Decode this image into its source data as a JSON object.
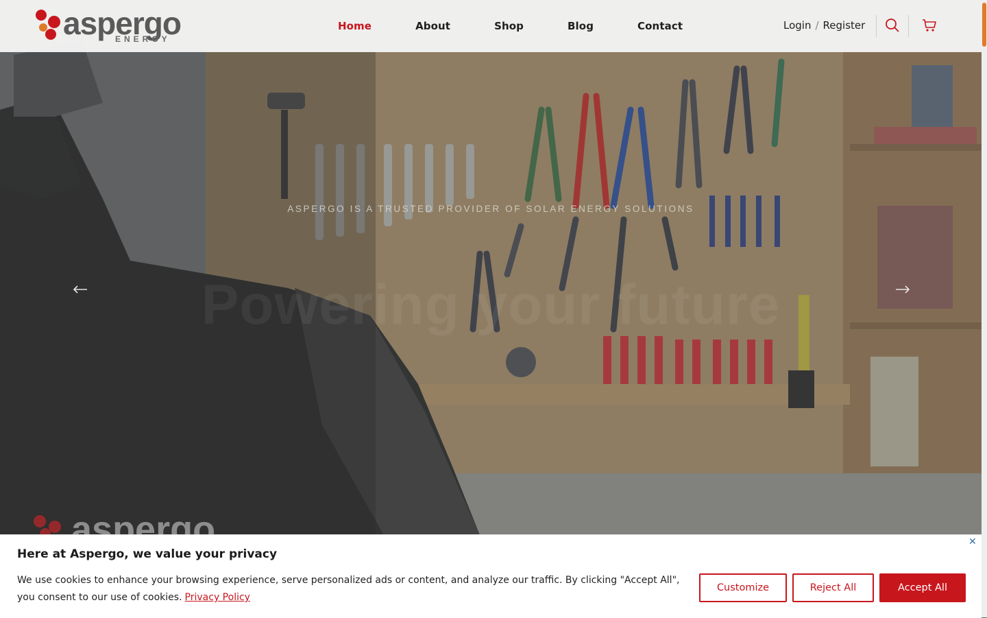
{
  "brand": {
    "logo_text": "aspergo",
    "logo_sub": "ENERGY",
    "primary_color": "#c8161d",
    "accent_color": "#e07a2a"
  },
  "nav": {
    "items": [
      {
        "label": "Home",
        "active": true
      },
      {
        "label": "About",
        "active": false
      },
      {
        "label": "Shop",
        "active": false
      },
      {
        "label": "Blog",
        "active": false
      },
      {
        "label": "Contact",
        "active": false
      }
    ]
  },
  "account": {
    "login": "Login",
    "separator": "/",
    "register": "Register"
  },
  "header_icons": [
    "search-icon",
    "cart-icon"
  ],
  "hero": {
    "tagline": "ASPERGO IS A TRUSTED PROVIDER OF SOLAR ENERGY SOLUTIONS",
    "heading": "Powering your future",
    "jacket_logo": "aspergo",
    "prev_icon": "arrow-left-icon",
    "next_icon": "arrow-right-icon"
  },
  "cookie": {
    "title": "Here at Aspergo, we value your privacy",
    "text": "We use cookies to enhance your browsing experience, serve personalized ads or content, and analyze our traffic. By clicking \"Accept All\", you consent to our use of cookies.",
    "policy_link": "Privacy Policy",
    "close_icon": "close-icon",
    "buttons": {
      "customize": "Customize",
      "reject": "Reject All",
      "accept": "Accept All"
    }
  }
}
